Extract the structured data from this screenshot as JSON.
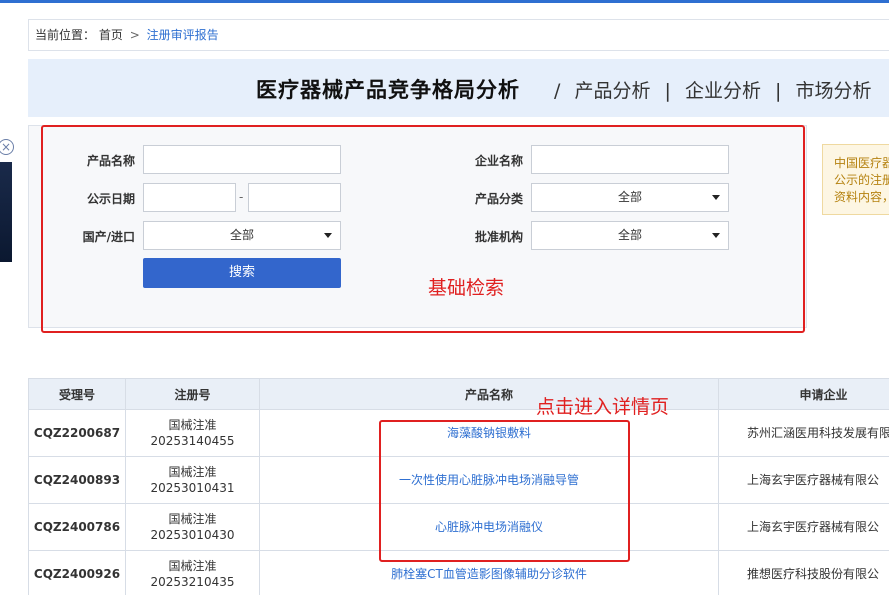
{
  "breadcrumb": {
    "label": "当前位置：",
    "home": "首页",
    "sep": ">",
    "current": "注册审评报告"
  },
  "banner": {
    "title": "医疗器械产品竞争格局分析",
    "sep": "/",
    "nav": [
      "产品分析",
      "企业分析",
      "市场分析"
    ]
  },
  "side": {
    "close": "×"
  },
  "search": {
    "product_name_label": "产品名称",
    "product_name_value": "",
    "company_name_label": "企业名称",
    "company_name_value": "",
    "date_label": "公示日期",
    "date_sep": "-",
    "date_from": "",
    "date_to": "",
    "category_label": "产品分类",
    "category_value": "全部",
    "origin_label": "国产/进口",
    "origin_value": "全部",
    "agency_label": "批准机构",
    "agency_value": "全部",
    "button_label": "搜索"
  },
  "annotations": {
    "basic": "基础检索",
    "detail": "点击进入详情页"
  },
  "notice": {
    "lines": [
      "中国医疗器",
      "公示的注册",
      "资料内容，"
    ]
  },
  "colors": {
    "accent": "#3366cc",
    "annotation": "#e02020"
  },
  "table": {
    "headers": [
      "受理号",
      "注册号",
      "产品名称",
      "申请企业"
    ],
    "rows": [
      {
        "accept": "CQZ2200687",
        "reg1": "国械注准",
        "reg2": "20253140455",
        "product": "海藻酸钠银敷料",
        "company": "苏州汇涵医用科技发展有限"
      },
      {
        "accept": "CQZ2400893",
        "reg1": "国械注准",
        "reg2": "20253010431",
        "product": "一次性使用心脏脉冲电场消融导管",
        "company": "上海玄宇医疗器械有限公"
      },
      {
        "accept": "CQZ2400786",
        "reg1": "国械注准",
        "reg2": "20253010430",
        "product": "心脏脉冲电场消融仪",
        "company": "上海玄宇医疗器械有限公"
      },
      {
        "accept": "CQZ2400926",
        "reg1": "国械注准",
        "reg2": "20253210435",
        "product": "肺栓塞CT血管造影图像辅助分诊软件",
        "company": "推想医疗科技股份有限公"
      }
    ]
  }
}
